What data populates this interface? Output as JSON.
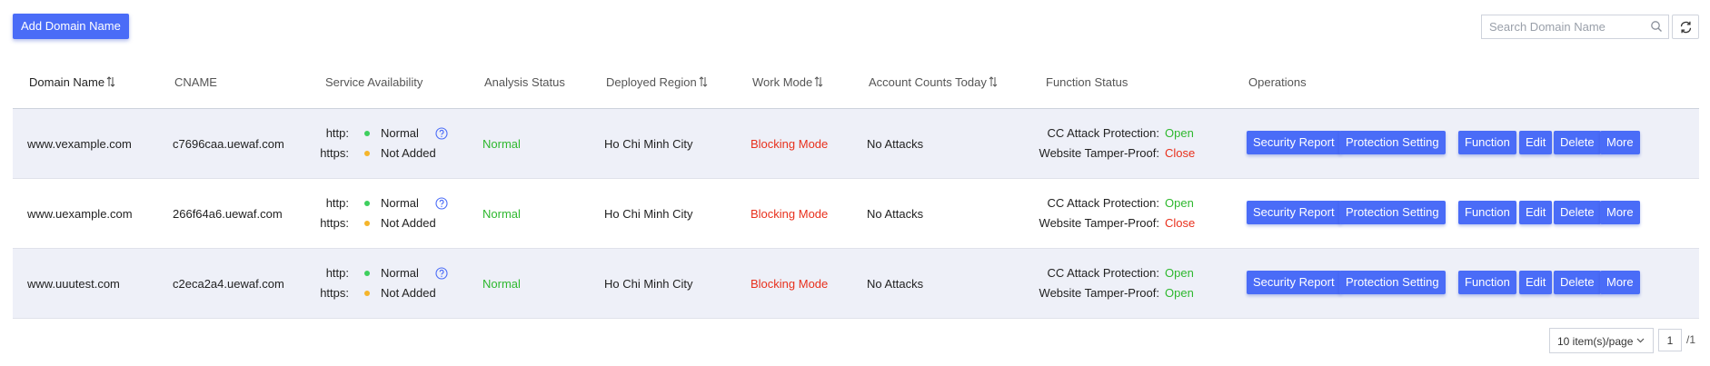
{
  "toolbar": {
    "add_label": "Add Domain Name",
    "search_placeholder": "Search Domain Name",
    "search_value": ""
  },
  "columns": {
    "domain": "Domain Name",
    "cname": "CNAME",
    "service": "Service Availability",
    "analysis": "Analysis Status",
    "region": "Deployed Region",
    "mode": "Work Mode",
    "counts": "Account Counts Today",
    "function": "Function Status",
    "operations": "Operations"
  },
  "labels": {
    "http": "http:",
    "https": "https:",
    "cc": "CC Attack Protection:",
    "tamper": "Website Tamper-Proof:"
  },
  "operations": [
    "Security Report",
    "Protection Setting",
    "Function",
    "Edit",
    "Delete",
    "More"
  ],
  "rows": [
    {
      "domain": "www.vexample.com",
      "cname": "c7696caa.uewaf.com",
      "http_status": "Normal",
      "https_status": "Not Added",
      "analysis": "Normal",
      "region": "Ho Chi Minh City",
      "mode": "Blocking Mode",
      "counts": "No Attacks",
      "cc_state": "Open",
      "tamper_state": "Close"
    },
    {
      "domain": "www.uexample.com",
      "cname": "266f64a6.uewaf.com",
      "http_status": "Normal",
      "https_status": "Not Added",
      "analysis": "Normal",
      "region": "Ho Chi Minh City",
      "mode": "Blocking Mode",
      "counts": "No Attacks",
      "cc_state": "Open",
      "tamper_state": "Close"
    },
    {
      "domain": "www.uuutest.com",
      "cname": "c2eca2a4.uewaf.com",
      "http_status": "Normal",
      "https_status": "Not Added",
      "analysis": "Normal",
      "region": "Ho Chi Minh City",
      "mode": "Blocking Mode",
      "counts": "No Attacks",
      "cc_state": "Open",
      "tamper_state": "Open"
    }
  ],
  "pagination": {
    "page_size": "10 item(s)/page",
    "current_page": "1",
    "total": "/1"
  },
  "colors": {
    "primary": "#4a6cf7",
    "ok": "#2eb82e",
    "danger": "#e8301c",
    "warn_dot": "#f5b52b",
    "row_shade": "#eef0f8"
  },
  "icons": [
    "search-icon",
    "refresh-icon",
    "sort-icon",
    "help-icon",
    "chevron-down-icon"
  ]
}
